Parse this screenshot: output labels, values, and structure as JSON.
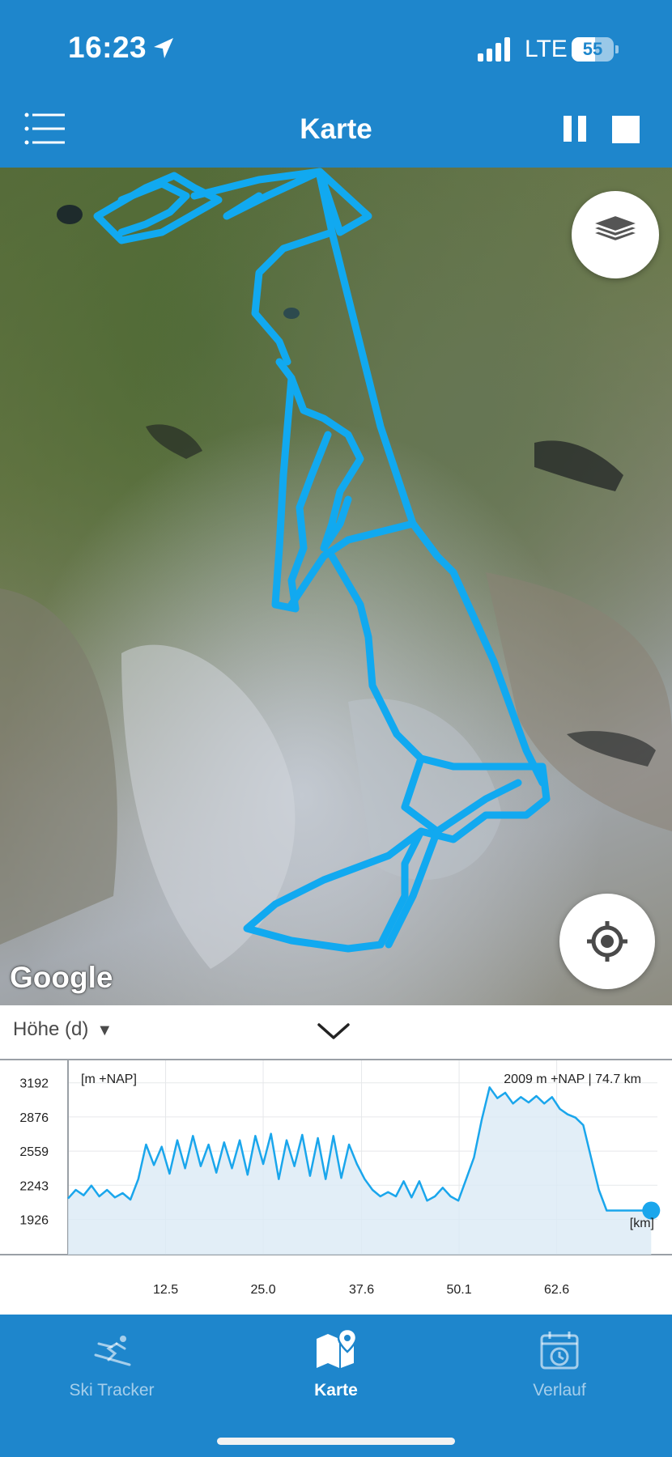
{
  "status_bar": {
    "time": "16:23",
    "network": "LTE",
    "battery": "55",
    "battery_level": 0.55
  },
  "header": {
    "title": "Karte"
  },
  "map": {
    "attribution": "Google",
    "track_color": "#11A9F0"
  },
  "chart_panel": {
    "metric_label": "Höhe (d)",
    "metric_caret": "▼"
  },
  "chart_data": {
    "type": "area",
    "ylabel": "[m +NAP]",
    "xlabel": "[km]",
    "readout": "2009 m +NAP | 74.7  km",
    "yticks": [
      "3192",
      "2876",
      "2559",
      "2243",
      "1926"
    ],
    "xticks": [
      "12.5",
      "25.0",
      "37.6",
      "50.1",
      "62.6"
    ],
    "xlim": [
      0,
      75.5
    ],
    "ylim": [
      1600,
      3400
    ],
    "series": [
      {
        "x": [
          0,
          1.0,
          2.0,
          3.0,
          4.0,
          5.0,
          6.0,
          7.0,
          8.0,
          9.0,
          10.0,
          11.0,
          12.0,
          13.0,
          14.0,
          15.0,
          16.0,
          17.0,
          18.0,
          19.0,
          20.0,
          21.0,
          22.0,
          23.0,
          24.0,
          25.0,
          26.0,
          27.0,
          28.0,
          29.0,
          30.0,
          31.0,
          32.0,
          33.0,
          34.0,
          35.0,
          36.0,
          37.0,
          38.0,
          39.0,
          40.0,
          41.0,
          42.0,
          43.0,
          44.0,
          45.0,
          46.0,
          47.0,
          48.0,
          49.0,
          50.0,
          51.0,
          52.0,
          53.0,
          54.0,
          55.0,
          56.0,
          57.0,
          58.0,
          59.0,
          60.0,
          61.0,
          62.0,
          63.0,
          64.0,
          65.0,
          66.0,
          67.0,
          68.0,
          69.0,
          70.0,
          71.0,
          72.0,
          73.0,
          74.0,
          74.7
        ],
        "values": [
          2120,
          2200,
          2150,
          2240,
          2140,
          2200,
          2130,
          2170,
          2110,
          2300,
          2620,
          2430,
          2600,
          2350,
          2660,
          2400,
          2700,
          2420,
          2620,
          2360,
          2640,
          2400,
          2660,
          2340,
          2700,
          2440,
          2720,
          2300,
          2660,
          2420,
          2710,
          2330,
          2680,
          2300,
          2700,
          2310,
          2620,
          2440,
          2300,
          2200,
          2140,
          2180,
          2140,
          2280,
          2130,
          2280,
          2100,
          2140,
          2220,
          2140,
          2100,
          2300,
          2500,
          2850,
          3150,
          3050,
          3100,
          3000,
          3060,
          3010,
          3070,
          3000,
          3060,
          2950,
          2900,
          2870,
          2800,
          2500,
          2200,
          2009,
          2009,
          2009,
          2009,
          2009,
          2009,
          2009
        ]
      }
    ],
    "grid": true,
    "color": "#1AA6EC"
  },
  "bottom_nav": {
    "items": [
      {
        "label": "Ski Tracker"
      },
      {
        "label": "Karte"
      },
      {
        "label": "Verlauf"
      }
    ]
  }
}
